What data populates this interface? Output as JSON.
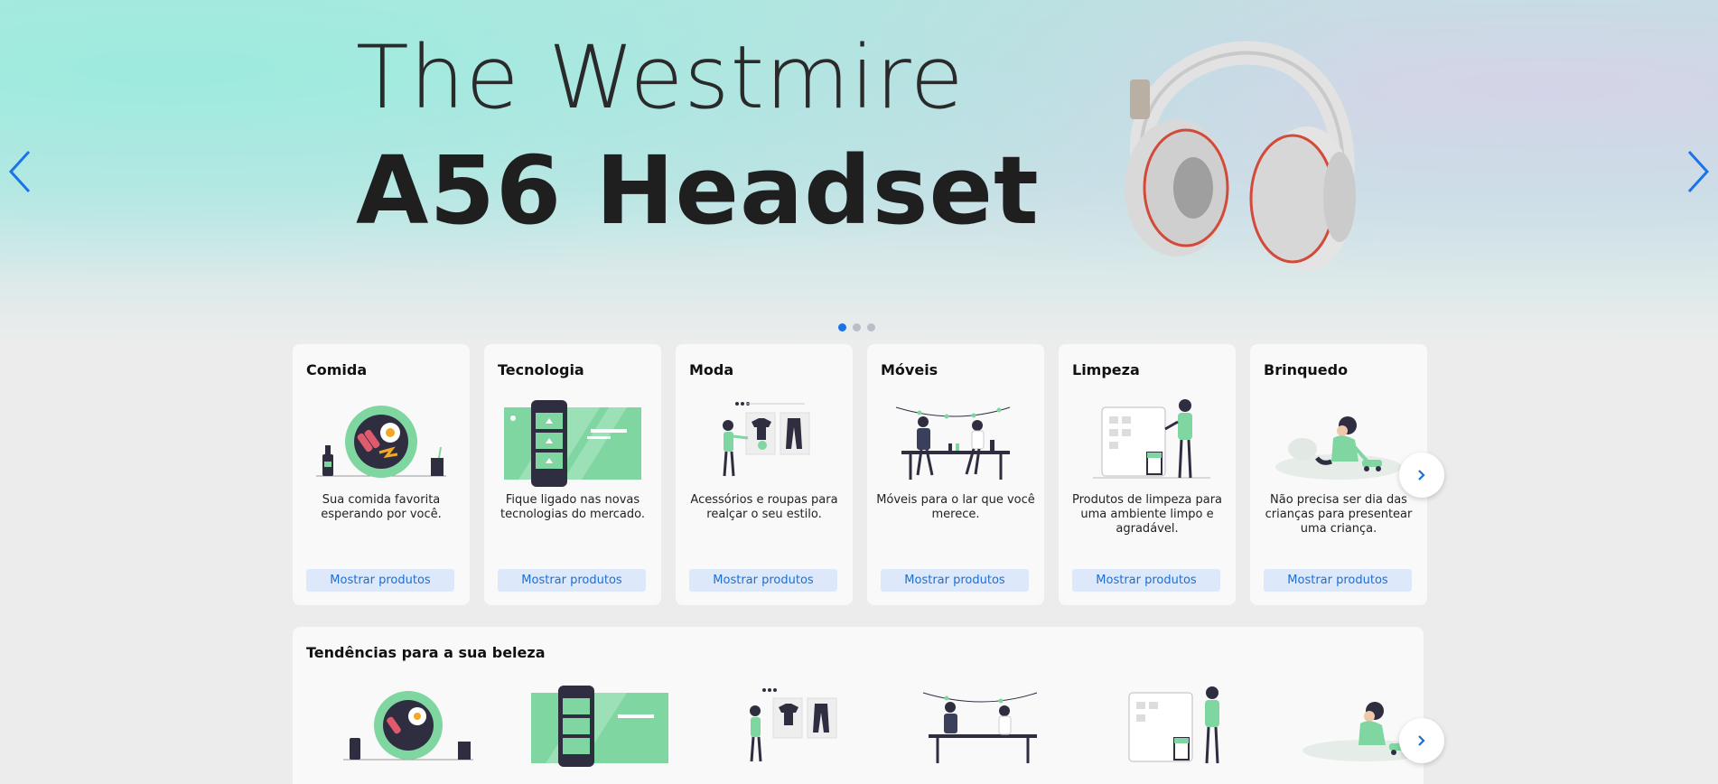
{
  "hero": {
    "title_line1": "The Westmire",
    "title_line2": "A56 Headset",
    "prev_icon": "chevron-left-icon",
    "next_icon": "chevron-right-icon",
    "slide_count": 3,
    "active_slide": 1,
    "accent": "#1a73e8"
  },
  "categories": [
    {
      "title": "Comida",
      "desc": "Sua comida favorita esperando por você.",
      "button": "Mostrar produtos"
    },
    {
      "title": "Tecnologia",
      "desc": "Fique ligado nas novas tecnologias do mercado.",
      "button": "Mostrar produtos"
    },
    {
      "title": "Moda",
      "desc": "Acessórios e roupas para realçar o seu estilo.",
      "button": "Mostrar produtos"
    },
    {
      "title": "Móveis",
      "desc": "Móveis para o lar que você merece.",
      "button": "Mostrar produtos"
    },
    {
      "title": "Limpeza",
      "desc": "Produtos de limpeza para uma ambiente limpo e agradável.",
      "button": "Mostrar produtos"
    },
    {
      "title": "Brinquedo",
      "desc": "Não precisa ser dia das crianças para presentear uma criança.",
      "button": "Mostrar produtos"
    }
  ],
  "trends": {
    "title": "Tendências para a sua beleza"
  },
  "colors": {
    "illustration_green": "#7fd6a0",
    "dark": "#2f2e41",
    "button_bg": "#dde9fb",
    "button_text": "#1a6fd6"
  }
}
